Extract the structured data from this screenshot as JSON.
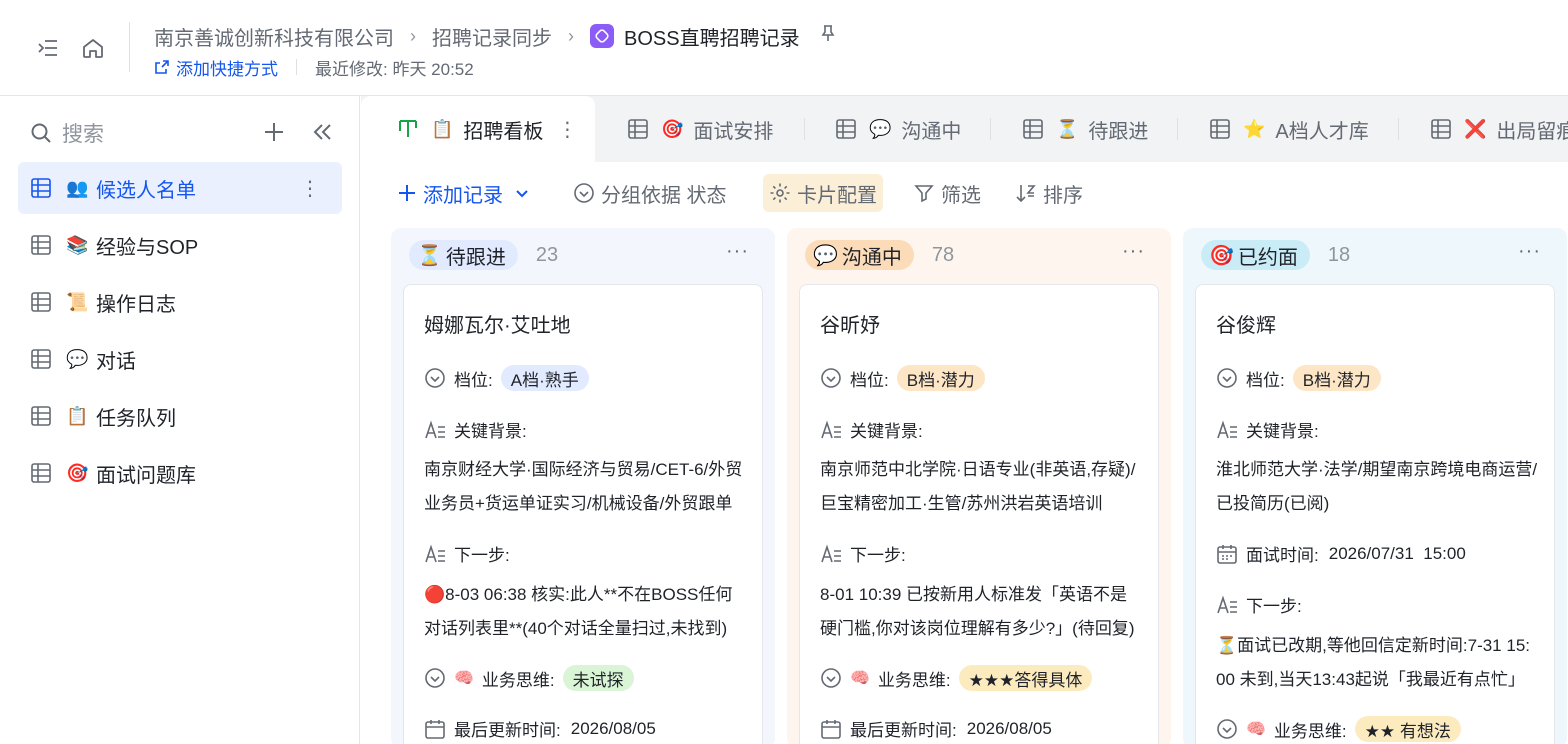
{
  "header": {
    "breadcrumb": [
      "南京善诚创新科技有限公司",
      "招聘记录同步",
      "BOSS直聘招聘记录"
    ],
    "add_shortcut": "添加快捷方式",
    "last_modified": "最近修改: 昨天 20:52"
  },
  "sidebar": {
    "search_placeholder": "搜索",
    "items": [
      {
        "emoji": "👥",
        "label": "候选人名单"
      },
      {
        "emoji": "📚",
        "label": "经验与SOP"
      },
      {
        "emoji": "📜",
        "label": "操作日志"
      },
      {
        "emoji": "💬",
        "label": "对话"
      },
      {
        "emoji": "📋",
        "label": "任务队列"
      },
      {
        "emoji": "🎯",
        "label": "面试问题库"
      }
    ]
  },
  "tabs": [
    {
      "emoji": "📋",
      "label": "招聘看板"
    },
    {
      "emoji": "🎯",
      "label": "面试安排"
    },
    {
      "emoji": "💬",
      "label": "沟通中"
    },
    {
      "emoji": "⏳",
      "label": "待跟进"
    },
    {
      "emoji": "⭐",
      "label": "A档人才库"
    },
    {
      "emoji": "❌",
      "label": "出局留痕"
    }
  ],
  "toolbar": {
    "add_record": "添加记录",
    "group_by": "分组依据 状态",
    "card_config": "卡片配置",
    "filter": "筛选",
    "sort": "排序"
  },
  "columns": [
    {
      "emoji": "⏳",
      "status": "待跟进",
      "count": "23",
      "pill_color": "#e1eaff",
      "bg_color": "#f3f6fd",
      "card": {
        "name": "姆娜瓦尔·艾吐地",
        "level_label": "档位:",
        "level": "A档·熟手",
        "background_label": "关键背景:",
        "background": "南京财经大学·国际经济与贸易/CET-6/外贸业务员+货运单证实习/机械设备/外贸跟单",
        "next_label": "下一步:",
        "next": "🔴8-03 06:38 核实:此人**不在BOSS任何对话列表里**(40个对话全量扫过,未找到)",
        "biz_emoji": "🧠",
        "biz_label": "业务思维:",
        "biz": "未试探",
        "updated_label": "最后更新时间:",
        "updated": "2026/08/05"
      }
    },
    {
      "emoji": "💬",
      "status": "沟通中",
      "count": "78",
      "pill_color": "#fcdcb8",
      "bg_color": "#fef6ee",
      "card": {
        "name": "谷昕妤",
        "level_label": "档位:",
        "level": "B档·潜力",
        "background_label": "关键背景:",
        "background": "南京师范中北学院·日语专业(非英语,存疑)/巨宝精密加工·生管/苏州洪岩英语培训",
        "next_label": "下一步:",
        "next": "8-01 10:39 已按新用人标准发「英语不是硬门槛,你对该岗位理解有多少?」(待回复)",
        "biz_emoji": "🧠",
        "biz_label": "业务思维:",
        "biz": "★★★答得具体",
        "updated_label": "最后更新时间:",
        "updated": "2026/08/05"
      }
    },
    {
      "emoji": "🎯",
      "status": "已约面",
      "count": "18",
      "pill_color": "#c9ecf7",
      "bg_color": "#eef8fc",
      "card": {
        "name": "谷俊辉",
        "level_label": "档位:",
        "level": "B档·潜力",
        "background_label": "关键背景:",
        "background": "淮北师范大学·法学/期望南京跨境电商运营/已投简历(已阅)",
        "interview_label": "面试时间:",
        "interview_time": "2026/07/31  15:00",
        "next_label": "下一步:",
        "next": "⏳面试已改期,等他回信定新时间:7-31 15:00 未到,当天13:43起说「我最近有点忙」",
        "biz_emoji": "🧠",
        "biz_label": "业务思维:",
        "biz": "★★ 有想法"
      }
    }
  ]
}
